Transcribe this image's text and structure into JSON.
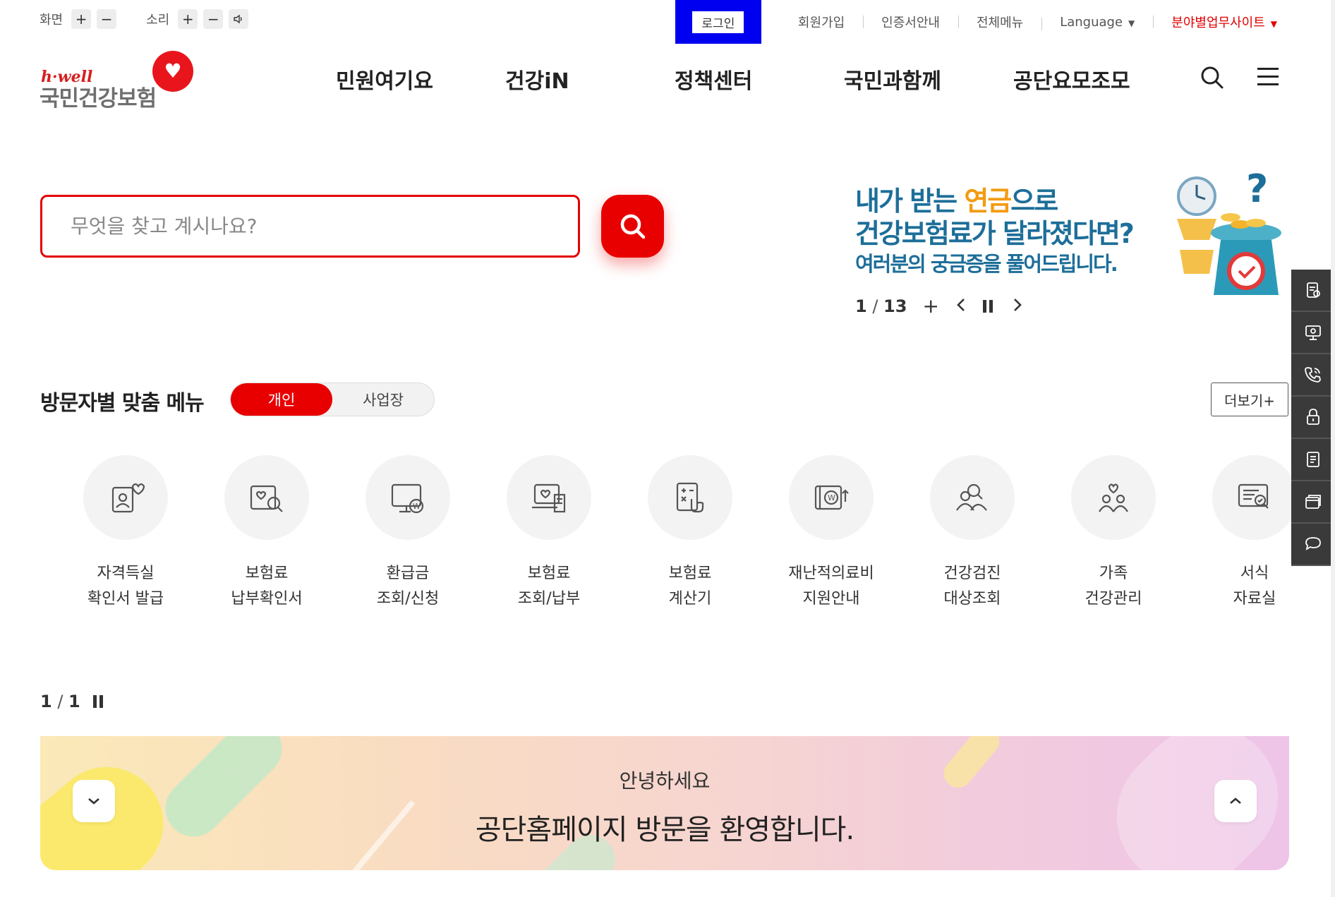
{
  "utility": {
    "screen_label": "화면",
    "sound_label": "소리",
    "plus": "+",
    "minus": "−",
    "login": "로그인",
    "links": [
      "회원가입",
      "인증서안내",
      "전체메뉴",
      "Language",
      "분야별업무사이트"
    ]
  },
  "logo": {
    "brand": "h·well",
    "name": "국민건강보험"
  },
  "gnb": {
    "items": [
      "민원여기요",
      "건강iN",
      "정책센터",
      "국민과함께",
      "공단요모조모"
    ]
  },
  "search": {
    "placeholder": "무엇을 찾고 계시나요?"
  },
  "banner": {
    "line1_a": "내가 받는 ",
    "line1_b": "연금",
    "line1_c": "으로",
    "line2": "건강보험료가 달라졌다면?",
    "line3": "여러분의 궁금증을 풀어드립니다.",
    "current": "1",
    "total": "13",
    "accent_color": "#f39b12",
    "text_color": "#1d6e99"
  },
  "quick_menu": {
    "title": "방문자별 맞춤 메뉴",
    "tab_personal": "개인",
    "tab_business": "사업장",
    "more": "더보기+",
    "items": [
      {
        "label": "자격득실\n확인서 발급",
        "icon": "id-card-heart-icon"
      },
      {
        "label": "보험료\n납부확인서",
        "icon": "search-heart-icon"
      },
      {
        "label": "환급금\n조회/신청",
        "icon": "monitor-won-icon"
      },
      {
        "label": "보험료\n조회/납부",
        "icon": "laptop-receipt-icon"
      },
      {
        "label": "보험료\n계산기",
        "icon": "calculator-icon"
      },
      {
        "label": "재난적의료비\n지원안내",
        "icon": "wallet-won-icon"
      },
      {
        "label": "건강검진\n대상조회",
        "icon": "people-search-icon"
      },
      {
        "label": "가족\n건강관리",
        "icon": "family-heart-icon"
      },
      {
        "label": "서식\n자료실",
        "icon": "document-search-icon"
      }
    ],
    "page_current": "1",
    "page_total": "1"
  },
  "welcome": {
    "sub": "안녕하세요",
    "main": "공단홈페이지 방문을 환영합니다."
  },
  "side_bar": {
    "items": [
      "certificate-icon",
      "monitor-icon",
      "phone-icon",
      "lock-icon",
      "document-icon",
      "window-icon",
      "chat-icon"
    ]
  },
  "colors": {
    "primary": "#e80000",
    "login_highlight": "#0000f0",
    "side_bar": "#3a3a3a"
  }
}
